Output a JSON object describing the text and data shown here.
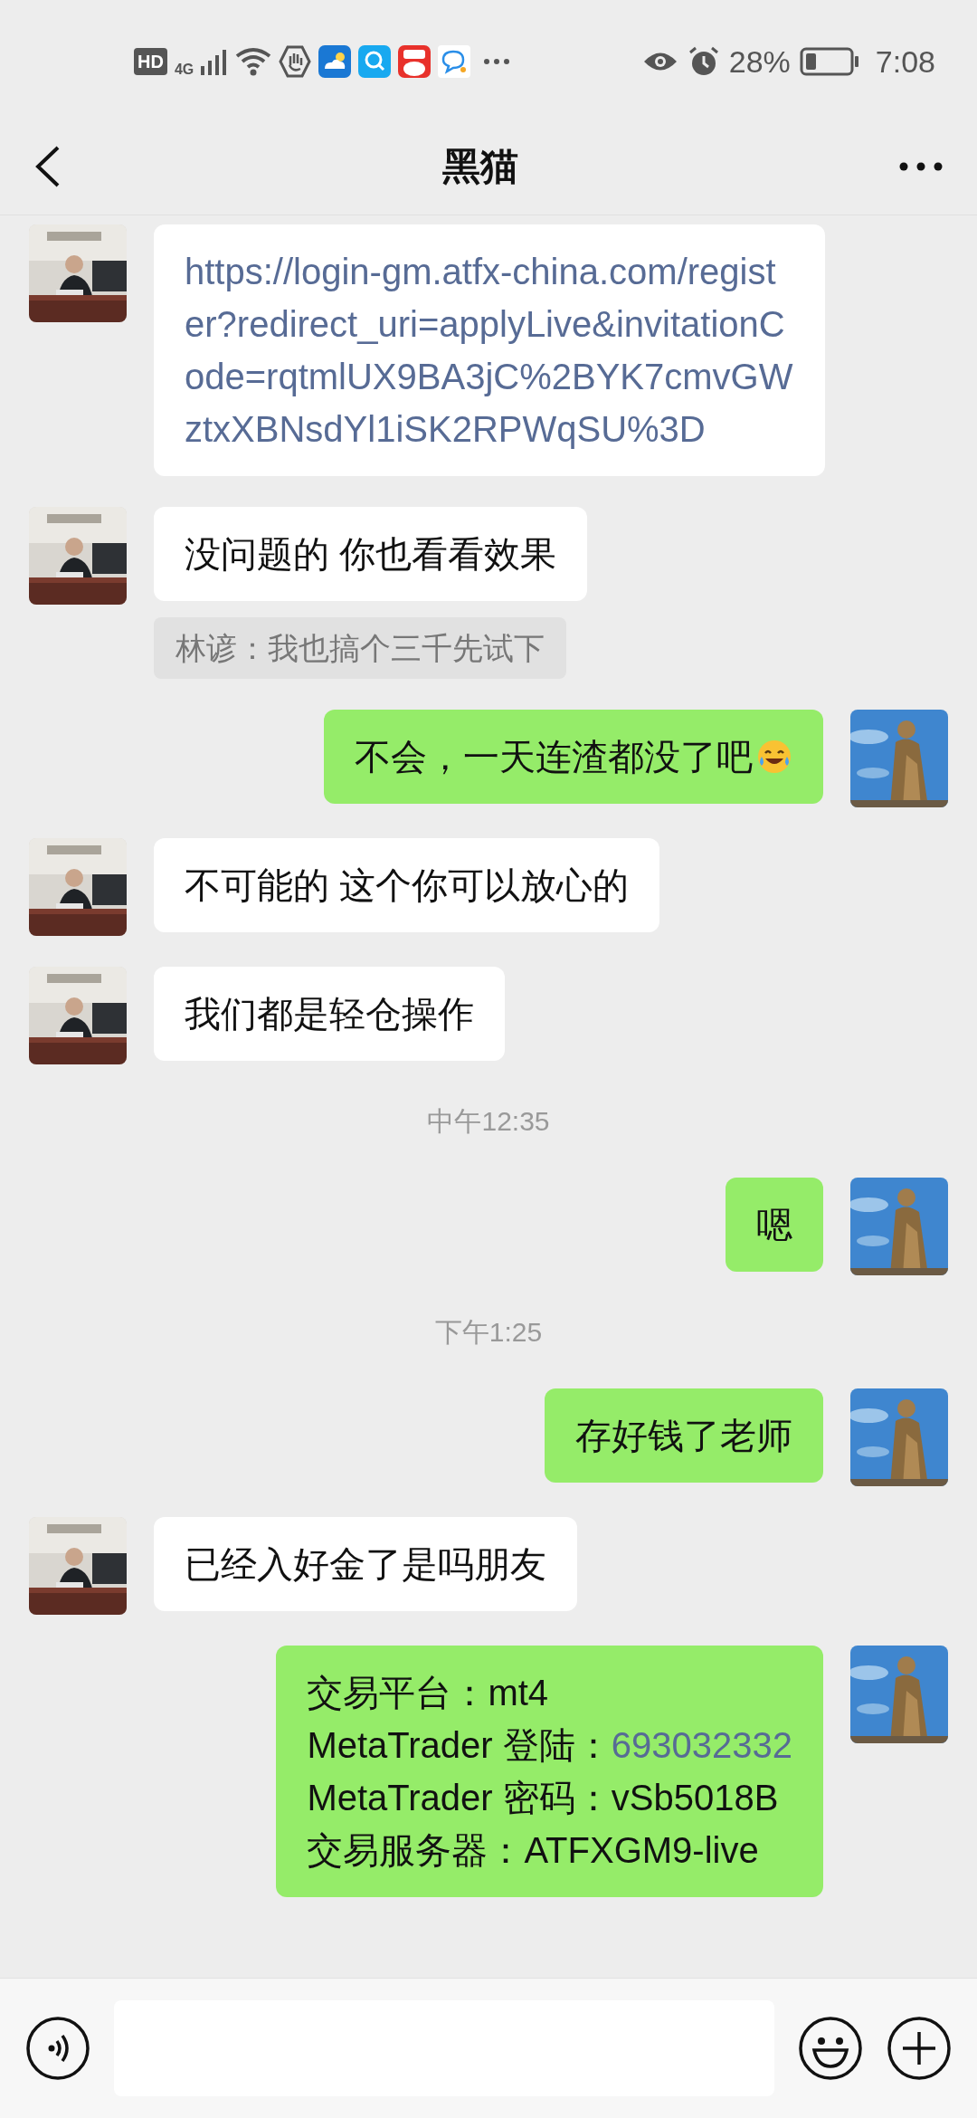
{
  "status_bar": {
    "hd": "HD",
    "network": "4G",
    "battery_percent": "28%",
    "time": "7:08"
  },
  "header": {
    "title": "黑猫"
  },
  "messages": [
    {
      "kind": "incoming",
      "link": true,
      "text": "https://login-gm.atfx-china.com/register?redirect_uri=applyLive&invitationCode=rqtmlUX9BA3jC%2BYK7cmvGWztxXBNsdYl1iSK2RPWqSU%3D"
    },
    {
      "kind": "incoming",
      "link": false,
      "text": "没问题的 你也看看效果"
    },
    {
      "kind": "quote",
      "text": "林谚：我也搞个三千先试下"
    },
    {
      "kind": "outgoing",
      "link": false,
      "emoji": true,
      "text": "不会，一天连渣都没了吧"
    },
    {
      "kind": "incoming",
      "link": false,
      "text": "不可能的 这个你可以放心的"
    },
    {
      "kind": "incoming",
      "link": false,
      "text": "我们都是轻仓操作"
    },
    {
      "kind": "time",
      "text": "中午12:35"
    },
    {
      "kind": "outgoing",
      "link": false,
      "text": "嗯"
    },
    {
      "kind": "time",
      "text": "下午1:25"
    },
    {
      "kind": "outgoing",
      "link": false,
      "text": "存好钱了老师"
    },
    {
      "kind": "incoming",
      "link": false,
      "text": "已经入好金了是吗朋友"
    },
    {
      "kind": "outgoing_lines",
      "lines": [
        {
          "text": "交易平台：mt4"
        },
        {
          "text": "MetaTrader 登陆：",
          "link_text": "693032332"
        },
        {
          "text": "MetaTrader 密码：vSb5018B"
        },
        {
          "text": "交易服务器：ATFXGM9-live"
        }
      ]
    }
  ]
}
